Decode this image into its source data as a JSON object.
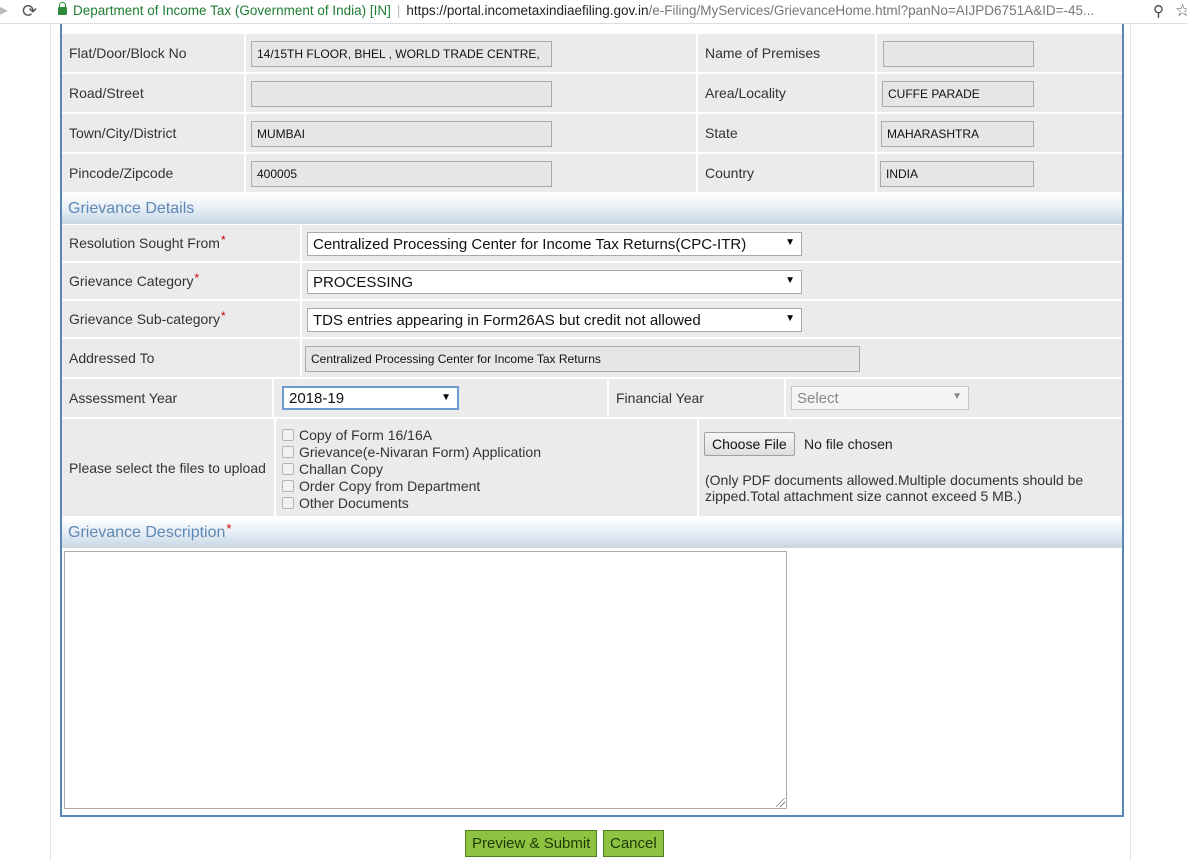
{
  "browser": {
    "site_name": "Department of Income Tax (Government of India) [IN]",
    "url_host": "https://portal.incometaxindiaefiling.gov.in",
    "url_path": "/e-Filing/MyServices/GrievanceHome.html?panNo=AIJPD6751A&ID=-45..."
  },
  "address": {
    "flat_label": "Flat/Door/Block No",
    "flat_value": "14/15TH FLOOR, BHEL , WORLD TRADE CENTRE,",
    "premises_label": "Name of Premises",
    "premises_value": "",
    "road_label": "Road/Street",
    "road_value": "",
    "area_label": "Area/Locality",
    "area_value": "CUFFE PARADE",
    "town_label": "Town/City/District",
    "town_value": "MUMBAI",
    "state_label": "State",
    "state_value": "MAHARASHTRA",
    "pincode_label": "Pincode/Zipcode",
    "pincode_value": "400005",
    "country_label": "Country",
    "country_value": "INDIA"
  },
  "grievance": {
    "section_title": "Grievance Details",
    "resolution_label": "Resolution Sought From",
    "resolution_value": "Centralized Processing Center for Income Tax Returns(CPC-ITR)",
    "category_label": "Grievance Category",
    "category_value": "PROCESSING",
    "subcategory_label": "Grievance Sub-category",
    "subcategory_value": "TDS entries appearing in Form26AS but credit not allowed",
    "addressed_label": "Addressed To",
    "addressed_value": "Centralized Processing Center for Income Tax Returns",
    "ay_label": "Assessment Year",
    "ay_value": "2018-19",
    "fy_label": "Financial Year",
    "fy_value": "Select",
    "upload_label": "Please select the files to upload",
    "upload_options": [
      "Copy of Form 16/16A",
      "Grievance(e-Nivaran Form) Application",
      "Challan Copy",
      "Order Copy from Department",
      "Other Documents"
    ],
    "choose_file_label": "Choose File",
    "no_file_text": "No file chosen",
    "upload_note": "(Only PDF documents allowed.Multiple documents should be zipped.Total attachment size cannot exceed 5 MB.)"
  },
  "description": {
    "section_title": "Grievance Description",
    "value": ""
  },
  "required_mark": "*",
  "actions": {
    "preview_submit_label": "Preview & Submit",
    "cancel_label": "Cancel"
  }
}
